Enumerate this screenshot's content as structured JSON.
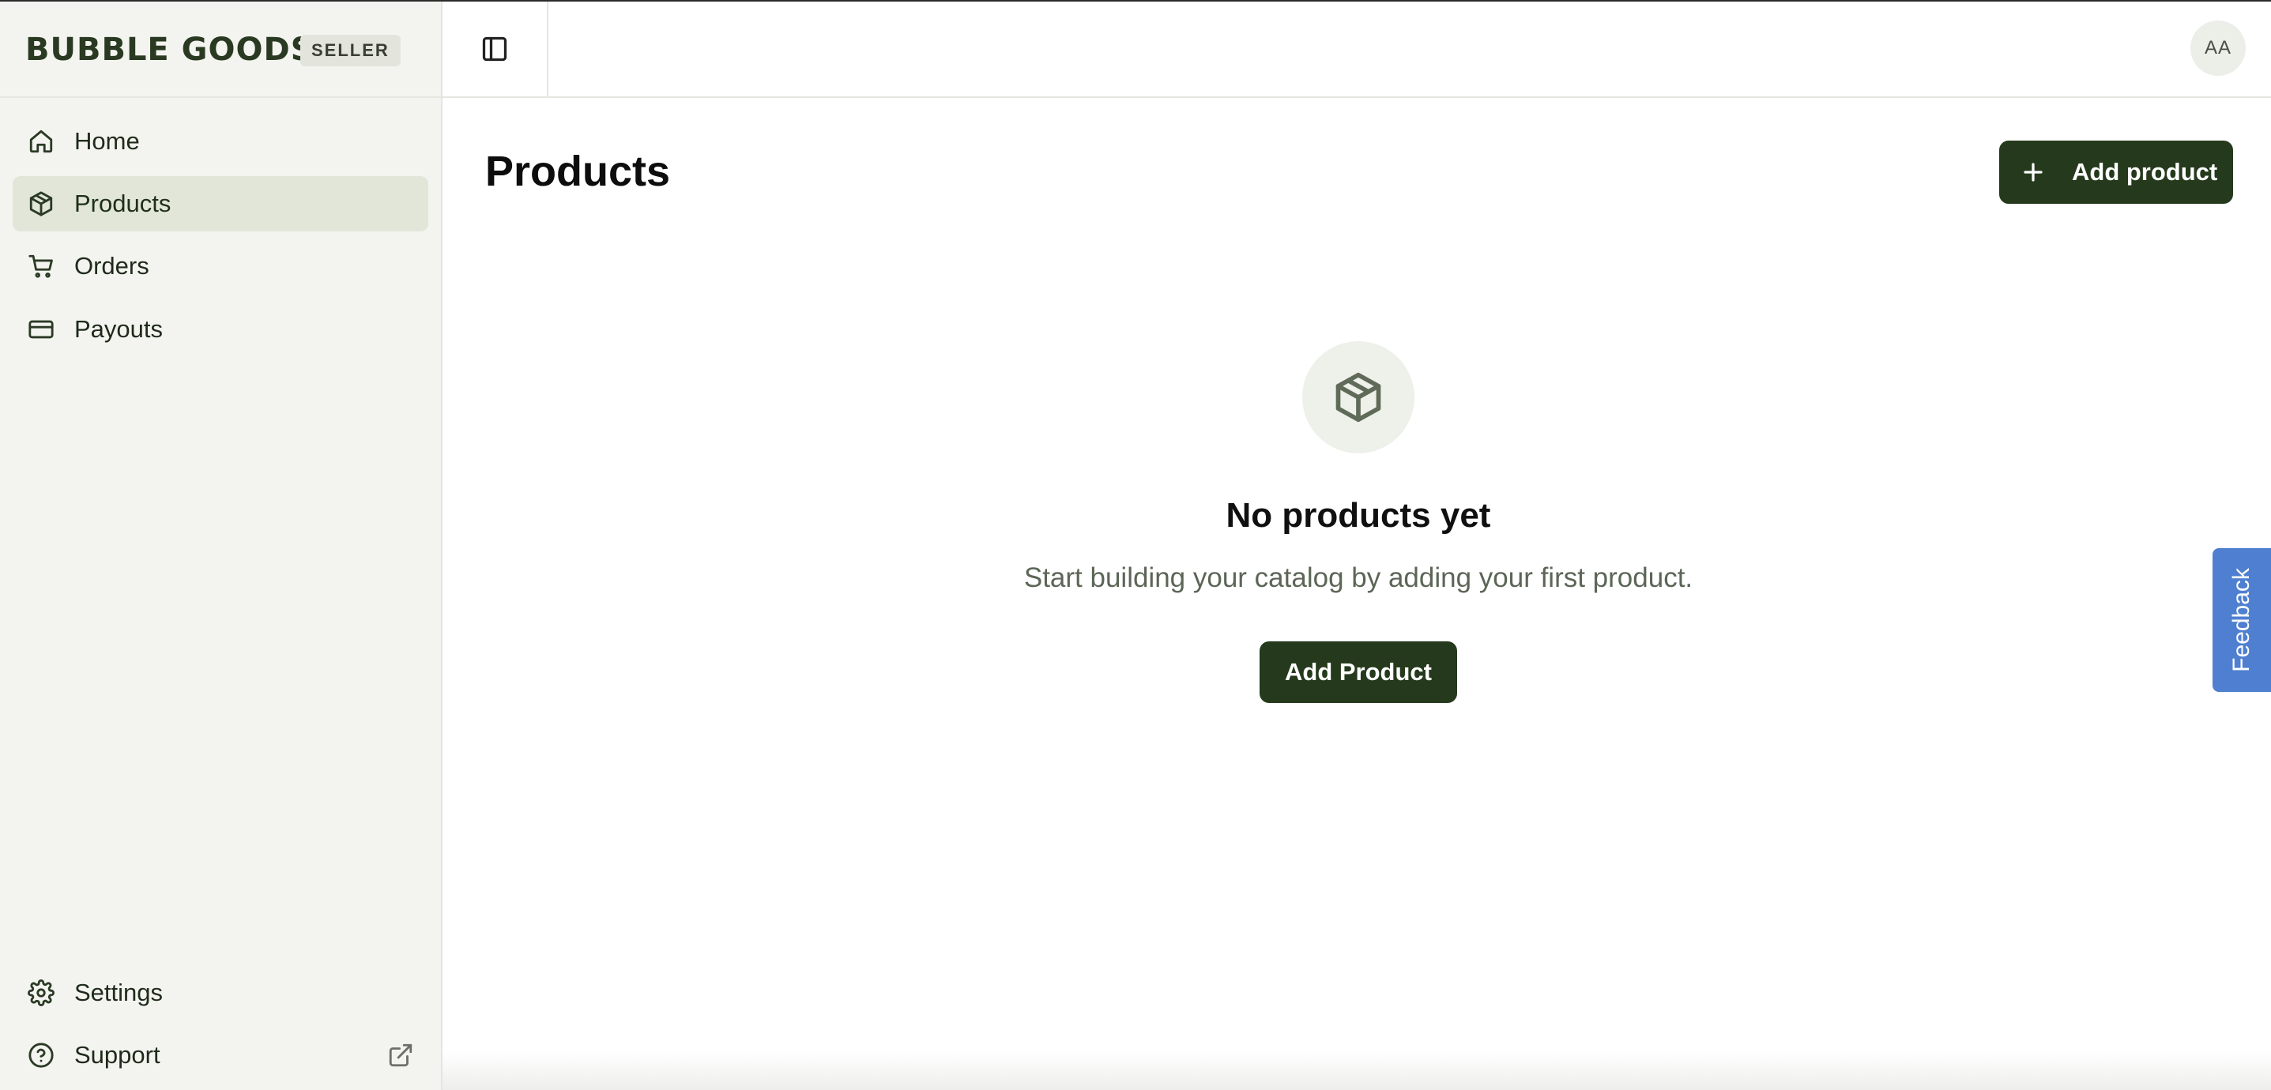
{
  "brand": {
    "logo": "BUBBLE GOODS",
    "badge": "SELLER"
  },
  "sidebar": {
    "items": [
      {
        "label": "Home",
        "icon": "home-icon",
        "active": false
      },
      {
        "label": "Products",
        "icon": "package-icon",
        "active": true
      },
      {
        "label": "Orders",
        "icon": "cart-icon",
        "active": false
      },
      {
        "label": "Payouts",
        "icon": "credit-card-icon",
        "active": false
      }
    ],
    "bottom_items": [
      {
        "label": "Settings",
        "icon": "gear-icon"
      },
      {
        "label": "Support",
        "icon": "help-circle-icon",
        "trailing_icon": "external-link-icon"
      }
    ]
  },
  "header": {
    "avatar_initials": "AA",
    "toggle_icon": "sidebar-toggle-icon"
  },
  "main": {
    "title": "Products",
    "add_button_label": "Add product",
    "empty_state": {
      "icon": "package-icon",
      "title": "No products yet",
      "subtitle": "Start building your catalog by adding your first product.",
      "button_label": "Add Product"
    }
  },
  "feedback_tab": {
    "label": "Feedback"
  },
  "colors": {
    "accent": "#253a1c",
    "sidebar_bg": "#f3f4ef",
    "active_item_bg": "#e2e6d9",
    "feedback": "#4f7fd0"
  }
}
